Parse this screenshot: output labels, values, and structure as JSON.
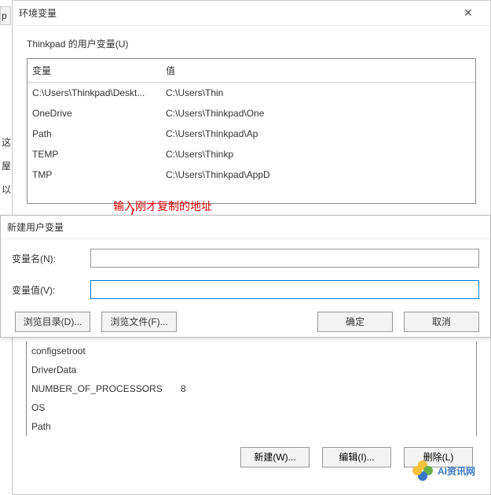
{
  "edge": {
    "l1": "这",
    "l2": "屋",
    "l3": "以"
  },
  "main": {
    "title": "环境变量",
    "userSection": "Thinkpad 的用户变量(U)",
    "colVar": "变量",
    "colVal": "值",
    "userVars": [
      {
        "name": "C:\\Users\\Thinkpad\\Deskt...",
        "value": "C:\\Users\\Thin"
      },
      {
        "name": "OneDrive",
        "value": "C:\\Users\\Thinkpad\\One"
      },
      {
        "name": "Path",
        "value": "C:\\Users\\Thinkpad\\Ap"
      },
      {
        "name": "TEMP",
        "value": "C:\\Users\\Thinkp"
      },
      {
        "name": "TMP",
        "value": "C:\\Users\\Thinkpad\\AppD"
      }
    ]
  },
  "annotation": "输入刚才复制的地址",
  "newDlg": {
    "title": "新建用户变量",
    "nameLabel": "变量名(N):",
    "valueLabel": "变量值(V):",
    "nameValue": "",
    "valueValue": "",
    "browseDir": "浏览目录(D)...",
    "browseFile": "浏览文件(F)...",
    "ok": "确定",
    "cancel": "取消"
  },
  "sys": {
    "rows": [
      {
        "name": "configsetroot",
        "value": ""
      },
      {
        "name": "DriverData",
        "value": ""
      },
      {
        "name": "NUMBER_OF_PROCESSORS",
        "value": "8"
      },
      {
        "name": "OS",
        "value": ""
      },
      {
        "name": "Path",
        "value": ""
      }
    ],
    "new": "新建(W)...",
    "edit": "编辑(I)...",
    "del": "删除(L)"
  },
  "watermark": "AI资讯网"
}
